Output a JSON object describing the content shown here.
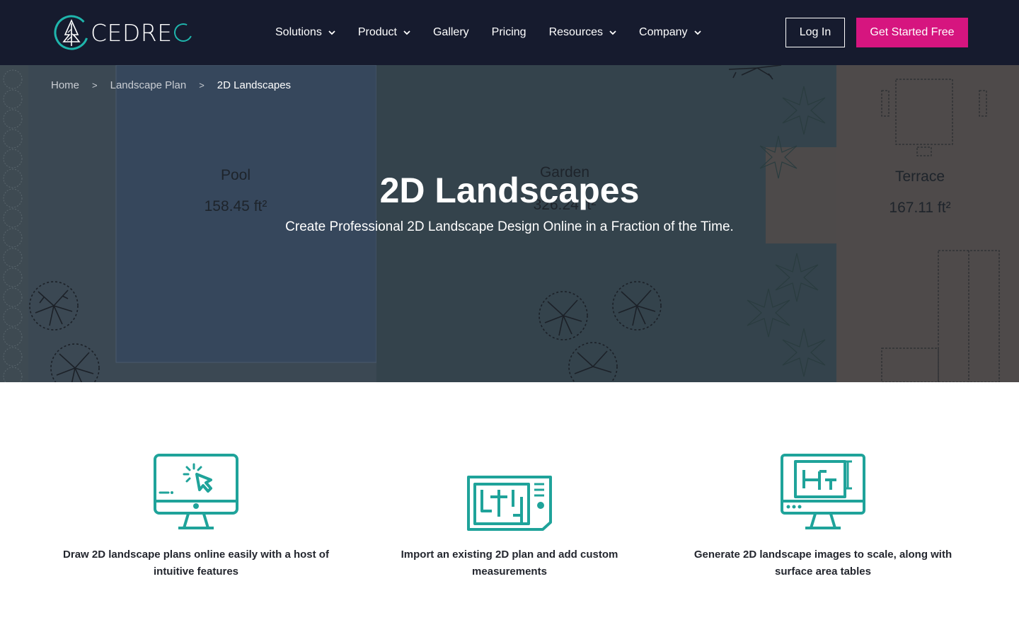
{
  "brand": {
    "name": "CEDRE",
    "accent": "#1fb5ac",
    "cta_color": "#d6157f",
    "nav_bg": "#161b2e"
  },
  "nav": {
    "items": [
      {
        "label": "Solutions",
        "has_dropdown": true
      },
      {
        "label": "Product",
        "has_dropdown": true
      },
      {
        "label": "Gallery",
        "has_dropdown": false
      },
      {
        "label": "Pricing",
        "has_dropdown": false
      },
      {
        "label": "Resources",
        "has_dropdown": true
      },
      {
        "label": "Company",
        "has_dropdown": true
      }
    ],
    "login_label": "Log In",
    "cta_label": "Get Started Free"
  },
  "breadcrumb": {
    "home": "Home",
    "parent": "Landscape Plan",
    "current": "2D Landscapes",
    "separator": ">"
  },
  "hero": {
    "title": "2D Landscapes",
    "subtitle": "Create Professional 2D Landscape Design Online in a Fraction of the Time.",
    "plan_labels": {
      "pool": "Pool",
      "pool_area": "158.45 ft²",
      "garden": "Garden",
      "garden_area": "326.24 ft²",
      "terrace": "Terrace",
      "terrace_area": "167.11 ft²"
    }
  },
  "features": [
    {
      "icon": "monitor-cursor-icon",
      "text": "Draw 2D landscape plans online easily with a host of intuitive features"
    },
    {
      "icon": "floor-plan-document-icon",
      "text": "Import an existing 2D plan and add custom measurements"
    },
    {
      "icon": "monitor-plan-icon",
      "text": "Generate 2D landscape images to scale, along with surface area tables"
    }
  ]
}
